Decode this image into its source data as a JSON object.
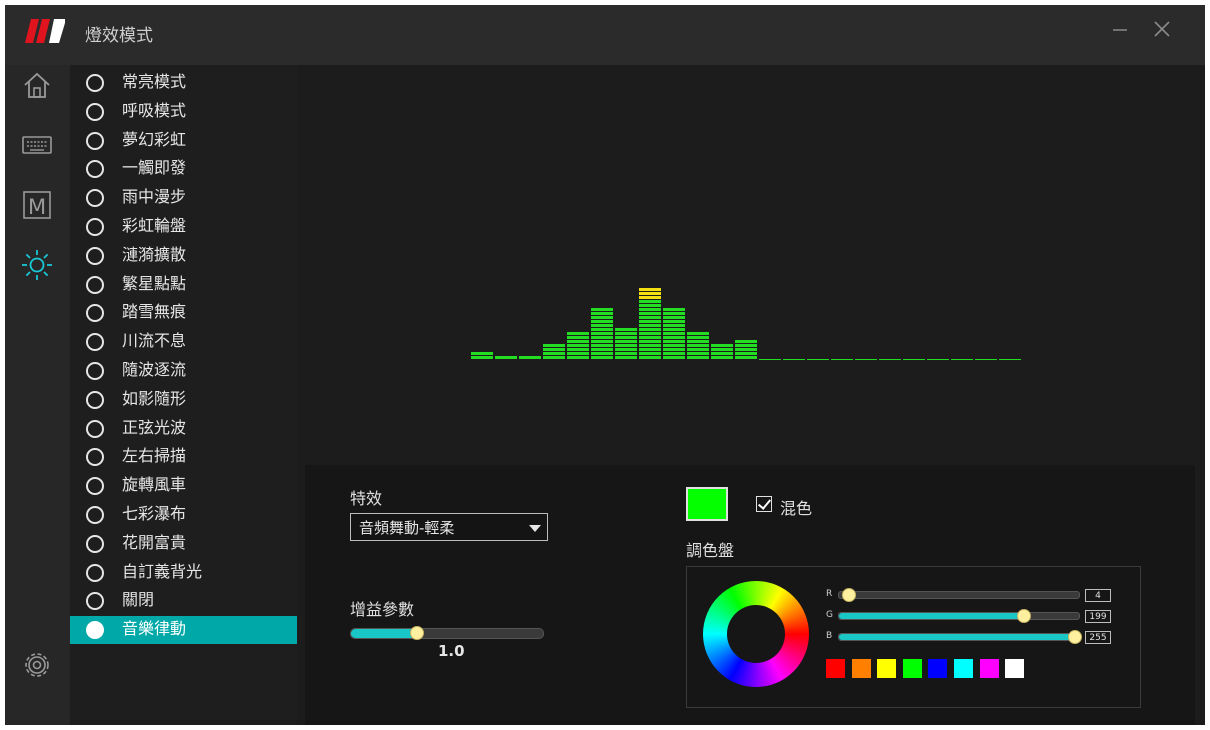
{
  "app": {
    "title": "燈效模式"
  },
  "nav": [
    "home-icon",
    "keyboard-icon",
    "macro-icon",
    "lighting-icon",
    "settings-icon"
  ],
  "nav_macro_letter": "M",
  "modes": [
    "常亮模式",
    "呼吸模式",
    "夢幻彩虹",
    "一觸即發",
    "雨中漫步",
    "彩虹輪盤",
    "漣漪擴散",
    "繁星點點",
    "踏雪無痕",
    "川流不息",
    "隨波逐流",
    "如影隨形",
    "正弦光波",
    "左右掃描",
    "旋轉風車",
    "七彩瀑布",
    "花開富貴",
    "自訂義背光",
    "關閉",
    "音樂律動"
  ],
  "selected_mode": "音樂律動",
  "effect": {
    "label": "特效",
    "value": "音頻舞動-輕柔"
  },
  "gain": {
    "label": "增益參數",
    "value": "1.0",
    "fraction": 0.34
  },
  "mix": {
    "label": "混色",
    "checked": true
  },
  "palette": {
    "label": "調色盤",
    "current_color": "#04ff00",
    "r": {
      "label": "R",
      "value": "4"
    },
    "g": {
      "label": "G",
      "value": "199"
    },
    "b": {
      "label": "B",
      "value": "255"
    },
    "swatches": [
      "#ff0000",
      "#ff8000",
      "#ffff00",
      "#00ff00",
      "#0000ff",
      "#00ffff",
      "#ff00ff",
      "#ffffff"
    ]
  },
  "equalizer": {
    "bar_color": "#22dd22",
    "peak_color": "#f4e010",
    "levels": [
      2,
      1,
      1,
      4,
      7,
      13,
      8,
      15,
      13,
      7,
      4,
      5,
      0,
      0,
      0,
      0,
      0,
      0,
      0,
      0,
      0,
      0,
      0
    ],
    "peaks": [
      0,
      0,
      0,
      0,
      0,
      0,
      0,
      3,
      0,
      0,
      0,
      0,
      0,
      0,
      0,
      0,
      0,
      0,
      0,
      0,
      0,
      0,
      0
    ],
    "max_level": 18
  }
}
